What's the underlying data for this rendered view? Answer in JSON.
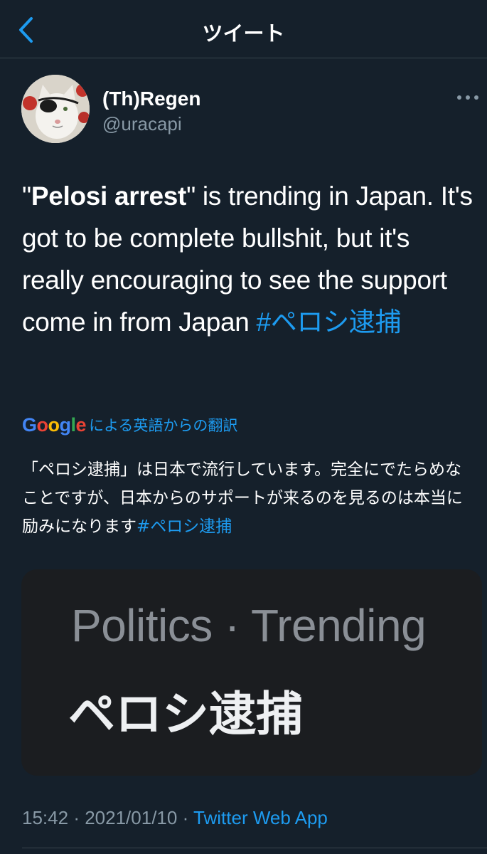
{
  "header": {
    "title": "ツイート",
    "back_icon": "chevron-left-icon"
  },
  "tweet": {
    "display_name": "(Th)Regen",
    "handle": "@uracapi",
    "more_icon": "more-horizontal-icon",
    "text": {
      "open_quote": "\"",
      "bold": "Pelosi arrest",
      "rest": "\" is trending in Japan. It's got to be complete bullshit, but it's really encouraging to see the support come in from Japan ",
      "hashtag": "#ペロシ逮捕"
    },
    "translation": {
      "provider": "Google",
      "label": "による英語からの翻訳",
      "text": "「ペロシ逮捕」は日本で流行しています。完全にでたらめなことですが、日本からのサポートが来るのを見るのは本当に励みになります",
      "hashtag": "#ペロシ逮捕"
    },
    "media": {
      "line1": "Politics · Trending",
      "line2": "ペロシ逮捕"
    },
    "meta": {
      "time": "15:42",
      "separator": "·",
      "date": "2021/01/10",
      "source": "Twitter Web App"
    }
  },
  "colors": {
    "background": "#15202b",
    "accent": "#1d9bf0",
    "secondary_text": "#8899a6",
    "divider": "#38444d"
  }
}
